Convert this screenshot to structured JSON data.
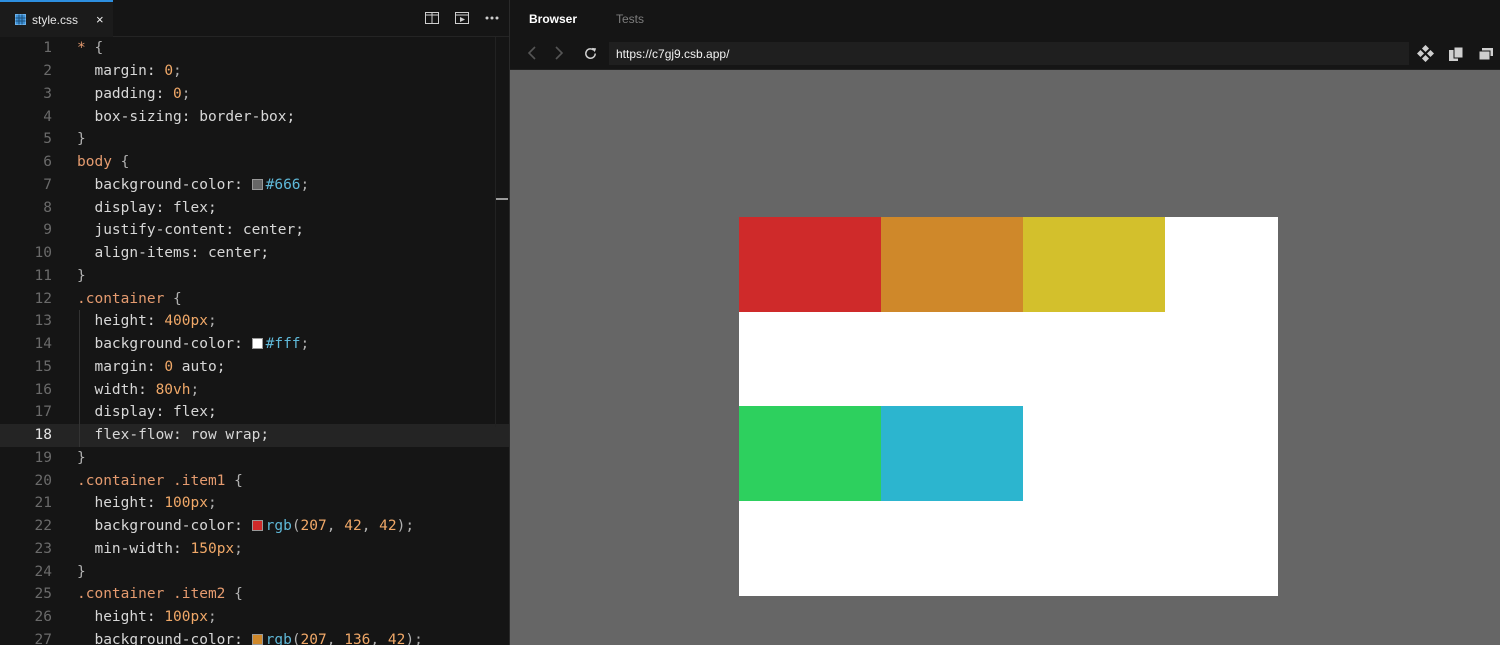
{
  "editor": {
    "tab_label": "style.css",
    "tab_close": "×",
    "active_line": 18,
    "lines": [
      {
        "n": "1",
        "tokens": [
          {
            "t": "* ",
            "c": "sel"
          },
          {
            "t": "{",
            "c": "punc"
          }
        ]
      },
      {
        "n": "2",
        "tokens": [
          {
            "t": "  margin: ",
            "c": "prop"
          },
          {
            "t": "0",
            "c": "num"
          },
          {
            "t": ";",
            "c": "punc"
          }
        ]
      },
      {
        "n": "3",
        "tokens": [
          {
            "t": "  padding: ",
            "c": "prop"
          },
          {
            "t": "0",
            "c": "num"
          },
          {
            "t": ";",
            "c": "punc"
          }
        ]
      },
      {
        "n": "4",
        "tokens": [
          {
            "t": "  box-sizing: border-box;",
            "c": "prop"
          }
        ]
      },
      {
        "n": "5",
        "tokens": [
          {
            "t": "}",
            "c": "punc"
          }
        ]
      },
      {
        "n": "6",
        "tokens": [
          {
            "t": "body ",
            "c": "sel"
          },
          {
            "t": "{",
            "c": "punc"
          }
        ]
      },
      {
        "n": "7",
        "tokens": [
          {
            "t": "  background-color: ",
            "c": "prop"
          },
          {
            "swatch": "#666666"
          },
          {
            "t": "#666",
            "c": "hex"
          },
          {
            "t": ";",
            "c": "punc"
          }
        ]
      },
      {
        "n": "8",
        "tokens": [
          {
            "t": "  display: flex;",
            "c": "prop"
          }
        ]
      },
      {
        "n": "9",
        "tokens": [
          {
            "t": "  justify-content: center;",
            "c": "prop"
          }
        ]
      },
      {
        "n": "10",
        "tokens": [
          {
            "t": "  align-items: center;",
            "c": "prop"
          }
        ]
      },
      {
        "n": "11",
        "tokens": [
          {
            "t": "}",
            "c": "punc"
          }
        ]
      },
      {
        "n": "12",
        "tokens": [
          {
            "t": ".container ",
            "c": "sel"
          },
          {
            "t": "{",
            "c": "punc"
          }
        ]
      },
      {
        "n": "13",
        "guide": true,
        "tokens": [
          {
            "t": "  height: ",
            "c": "prop"
          },
          {
            "t": "400px",
            "c": "num"
          },
          {
            "t": ";",
            "c": "punc"
          }
        ]
      },
      {
        "n": "14",
        "guide": true,
        "tokens": [
          {
            "t": "  background-color: ",
            "c": "prop"
          },
          {
            "swatch": "#ffffff"
          },
          {
            "t": "#fff",
            "c": "hex"
          },
          {
            "t": ";",
            "c": "punc"
          }
        ]
      },
      {
        "n": "15",
        "guide": true,
        "tokens": [
          {
            "t": "  margin: ",
            "c": "prop"
          },
          {
            "t": "0",
            "c": "num"
          },
          {
            "t": " auto;",
            "c": "prop"
          }
        ]
      },
      {
        "n": "16",
        "guide": true,
        "tokens": [
          {
            "t": "  width: ",
            "c": "prop"
          },
          {
            "t": "80vh",
            "c": "num"
          },
          {
            "t": ";",
            "c": "punc"
          }
        ]
      },
      {
        "n": "17",
        "guide": true,
        "tokens": [
          {
            "t": "  display: flex;",
            "c": "prop"
          }
        ]
      },
      {
        "n": "18",
        "guide": true,
        "tokens": [
          {
            "t": "  flex-flow: row wrap;",
            "c": "prop"
          }
        ]
      },
      {
        "n": "19",
        "tokens": [
          {
            "t": "}",
            "c": "punc"
          }
        ]
      },
      {
        "n": "20",
        "tokens": [
          {
            "t": ".container .item1 ",
            "c": "sel"
          },
          {
            "t": "{",
            "c": "punc"
          }
        ]
      },
      {
        "n": "21",
        "tokens": [
          {
            "t": "  height: ",
            "c": "prop"
          },
          {
            "t": "100px",
            "c": "num"
          },
          {
            "t": ";",
            "c": "punc"
          }
        ]
      },
      {
        "n": "22",
        "tokens": [
          {
            "t": "  background-color: ",
            "c": "prop"
          },
          {
            "swatch": "#cf2a2a"
          },
          {
            "t": "rgb",
            "c": "func"
          },
          {
            "t": "(",
            "c": "punc"
          },
          {
            "t": "207",
            "c": "num"
          },
          {
            "t": ", ",
            "c": "punc"
          },
          {
            "t": "42",
            "c": "num"
          },
          {
            "t": ", ",
            "c": "punc"
          },
          {
            "t": "42",
            "c": "num"
          },
          {
            "t": ");",
            "c": "punc"
          }
        ]
      },
      {
        "n": "23",
        "tokens": [
          {
            "t": "  min-width: ",
            "c": "prop"
          },
          {
            "t": "150px",
            "c": "num"
          },
          {
            "t": ";",
            "c": "punc"
          }
        ]
      },
      {
        "n": "24",
        "tokens": [
          {
            "t": "}",
            "c": "punc"
          }
        ]
      },
      {
        "n": "25",
        "tokens": [
          {
            "t": ".container .item2 ",
            "c": "sel"
          },
          {
            "t": "{",
            "c": "punc"
          }
        ]
      },
      {
        "n": "26",
        "tokens": [
          {
            "t": "  height: ",
            "c": "prop"
          },
          {
            "t": "100px",
            "c": "num"
          },
          {
            "t": ";",
            "c": "punc"
          }
        ]
      },
      {
        "n": "27",
        "tokens": [
          {
            "t": "  background-color: ",
            "c": "prop"
          },
          {
            "swatch": "#cf882a"
          },
          {
            "t": "rgb",
            "c": "func"
          },
          {
            "t": "(",
            "c": "punc"
          },
          {
            "t": "207",
            "c": "num"
          },
          {
            "t": ", ",
            "c": "punc"
          },
          {
            "t": "136",
            "c": "num"
          },
          {
            "t": ", ",
            "c": "punc"
          },
          {
            "t": "42",
            "c": "num"
          },
          {
            "t": ");",
            "c": "punc"
          }
        ]
      }
    ]
  },
  "browser": {
    "tab_browser": "Browser",
    "tab_tests": "Tests",
    "url": "https://c7gj9.csb.app/",
    "preview": {
      "page_background": "#666666",
      "container_background": "#ffffff",
      "items": [
        {
          "name": "preview-item1",
          "color": "#cf2a2a"
        },
        {
          "name": "preview-item2",
          "color": "#cf882a"
        },
        {
          "name": "preview-item3",
          "color": "#d3c02c"
        },
        {
          "name": "preview-item4",
          "color": "#2dd05e"
        },
        {
          "name": "preview-item5",
          "color": "#2cb5cf"
        }
      ]
    }
  },
  "icons": {
    "file_icon": "css-file-icon",
    "split": "split-view-icon",
    "preview": "open-preview-icon",
    "more": "more-icon",
    "back": "back-arrow-icon",
    "forward": "forward-arrow-icon",
    "reload": "reload-icon",
    "devtools": "devtools-icon",
    "copy": "copy-icon",
    "window": "new-window-icon"
  }
}
